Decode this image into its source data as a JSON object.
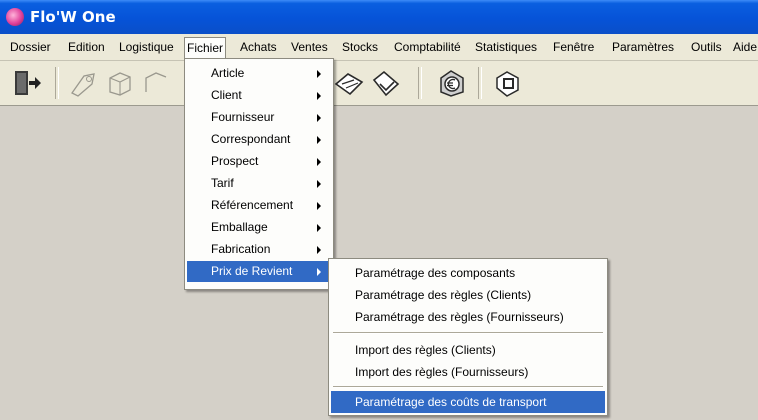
{
  "window": {
    "title": "Flo'W One"
  },
  "menubar": {
    "items": [
      "Dossier",
      "Edition",
      "Logistique",
      "Fichier",
      "Achats",
      "Ventes",
      "Stocks",
      "Comptabilité",
      "Statistiques",
      "Fenêtre",
      "Paramètres",
      "Outils",
      "Aide"
    ],
    "open": "Fichier"
  },
  "toolbar": {
    "icons": [
      "exit-door-icon",
      "tool-button-1-icon",
      "tool-button-2-icon",
      "tool-button-3-icon",
      "tool-button-4-icon",
      "tool-button-5-icon",
      "euro-icon",
      "window-icon"
    ]
  },
  "fichier_menu": {
    "items": [
      {
        "label": "Article",
        "submenu": true
      },
      {
        "label": "Client",
        "submenu": true
      },
      {
        "label": "Fournisseur",
        "submenu": true
      },
      {
        "label": "Correspondant",
        "submenu": true
      },
      {
        "label": "Prospect",
        "submenu": true
      },
      {
        "label": "Tarif",
        "submenu": true
      },
      {
        "label": "Référencement",
        "submenu": true
      },
      {
        "label": "Emballage",
        "submenu": true
      },
      {
        "label": "Fabrication",
        "submenu": true
      },
      {
        "label": "Prix de Revient",
        "submenu": true
      }
    ],
    "selected": "Prix de Revient"
  },
  "prix_de_revient_submenu": {
    "group1": [
      "Paramétrage des composants",
      "Paramétrage des règles (Clients)",
      "Paramétrage des règles (Fournisseurs)"
    ],
    "group2": [
      "Import des règles (Clients)",
      "Import des règles (Fournisseurs)"
    ],
    "group3": [
      "Paramétrage des coûts de transport"
    ],
    "selected": "Paramétrage des coûts de transport"
  },
  "colors": {
    "titlebar": "#0653d8",
    "highlight": "#316ac5",
    "menu_bg": "#ece9d8",
    "workspace": "#d4d0c8"
  }
}
